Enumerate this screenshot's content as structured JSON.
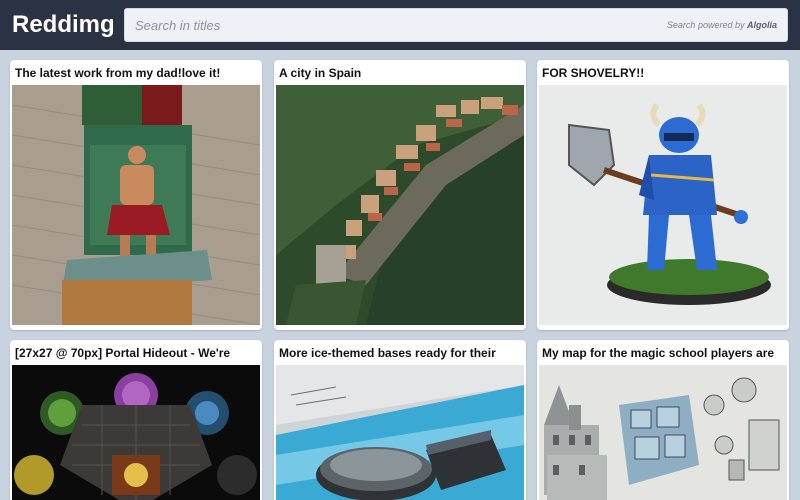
{
  "header": {
    "brand": "Reddimg",
    "search_placeholder": "Search in titles",
    "powered_prefix": "Search powered by",
    "powered_brand": "Algolia"
  },
  "posts": [
    {
      "title": "The latest work from my dad!love it!",
      "image_icon": "miniature-barbarian-throne"
    },
    {
      "title": "A city in Spain",
      "image_icon": "cliffside-city-aerial"
    },
    {
      "title": "FOR SHOVELRY!!",
      "image_icon": "shovel-knight-miniature"
    },
    {
      "title": "[27x27 @ 70px] Portal Hideout - We're",
      "image_icon": "battle-map-portal"
    },
    {
      "title": "More ice-themed bases ready for their",
      "image_icon": "ice-bases"
    },
    {
      "title": "My map for the magic school players are",
      "image_icon": "magic-school-map"
    }
  ]
}
